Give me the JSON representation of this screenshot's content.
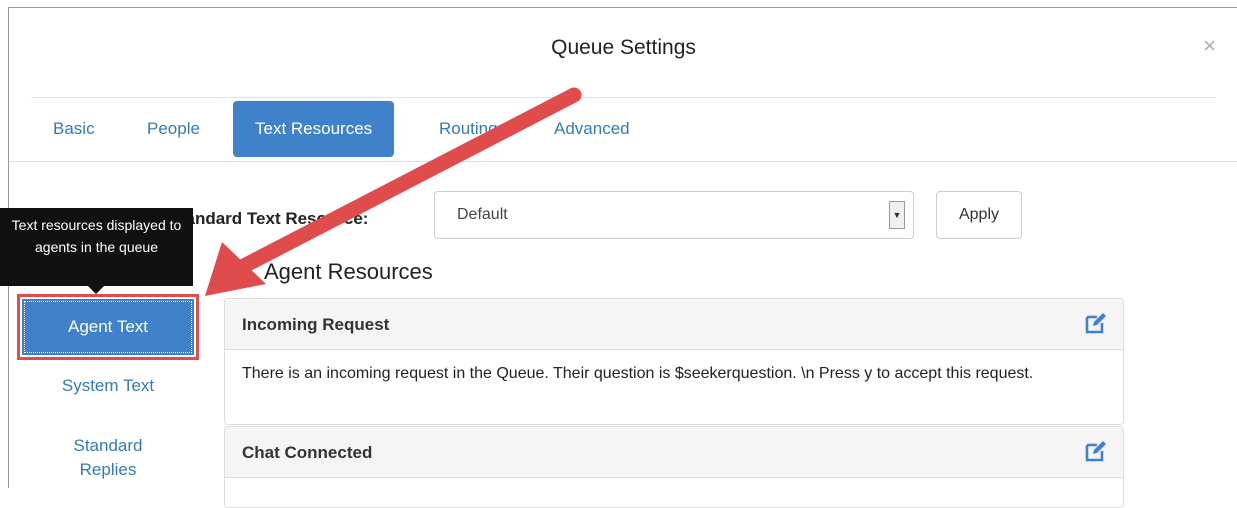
{
  "dialog": {
    "title": "Queue Settings",
    "close_glyph": "×"
  },
  "tabs": [
    {
      "label": "Basic",
      "active": false
    },
    {
      "label": "People",
      "active": false
    },
    {
      "label": "Text Resources",
      "active": true
    },
    {
      "label": "Routing",
      "active": false
    },
    {
      "label": "Advanced",
      "active": false
    }
  ],
  "load_resource": {
    "label": "Load a Standard Text Resource:",
    "selected": "Default",
    "apply_label": "Apply"
  },
  "section_heading": "Agent Resources",
  "sidebar": {
    "items": [
      {
        "label": "Agent Text",
        "active": true
      },
      {
        "label": "System Text",
        "active": false
      },
      {
        "label": "Standard Replies",
        "active": false
      }
    ]
  },
  "tooltip": {
    "text": "Text resources displayed to agents in the queue"
  },
  "resources": [
    {
      "title": "Incoming Request",
      "body": "There is an incoming request in the Queue. Their question is $seekerquestion. \\n Press y to accept this request."
    },
    {
      "title": "Chat Connected",
      "body": ""
    }
  ],
  "colors": {
    "accent": "#3f82c9",
    "link": "#337ab7",
    "annotation_arrow": "#e04b4b"
  },
  "icons": {
    "edit": "edit-icon",
    "close": "close-icon",
    "dropdown": "chevron-down-icon"
  }
}
